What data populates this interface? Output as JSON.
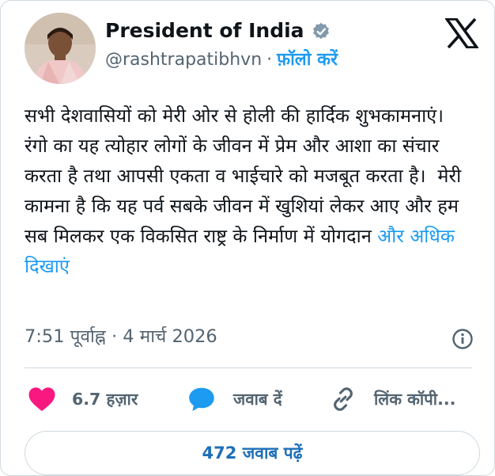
{
  "author": {
    "name": "President of India",
    "handle": "@rashtrapatibhvn",
    "separator": "·",
    "follow_label": "फ़ॉलो करें",
    "verified": true,
    "avatar_icon": "profile-photo"
  },
  "brand_icon": "x-logo",
  "tweet": {
    "text": "सभी देशवासियों को मेरी ओर से होली की हार्दिक शुभकामनाएं।\nरंगो का यह त्योहार लोगों के जीवन में प्रेम और आशा का संचार करता है तथा आपसी एकता व भाईचारे को मजबूत करता है।  मेरी कामना है कि यह पर्व सबके जीवन में खुशियां लेकर आए और हम सब मिलकर एक विकसित राष्ट्र के निर्माण में योगदान ",
    "show_more_label": "और अधिक दिखाएं"
  },
  "meta": {
    "time": "7:51 पूर्वाह्न",
    "separator": "·",
    "date": "4 मार्च 2026",
    "info_icon": "info-icon"
  },
  "actions": {
    "likes_count": "6.7 हज़ार",
    "reply_label": "जवाब दें",
    "copy_link_label": "लिंक कॉपी..."
  },
  "read_replies_label": "472 जवाब पढ़ें",
  "colors": {
    "accent": "#1d9bf0",
    "heart": "#f91880",
    "text_primary": "#0f1419",
    "text_secondary": "#536471",
    "border": "#cfd9de"
  }
}
